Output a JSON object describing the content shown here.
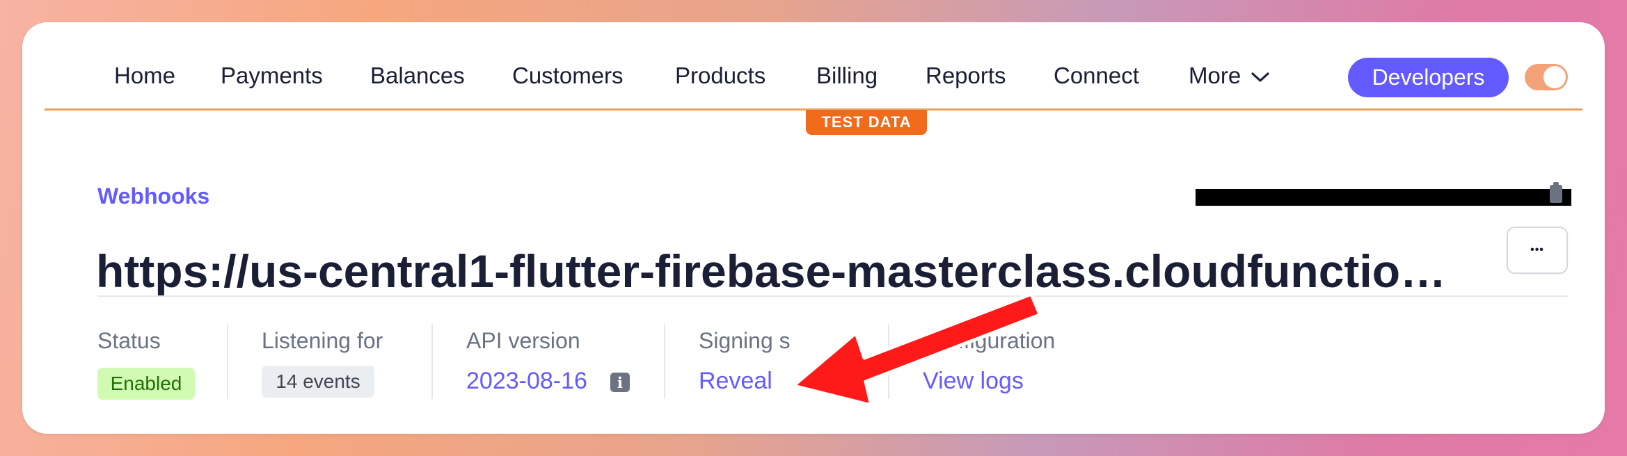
{
  "nav": {
    "items": [
      "Home",
      "Payments",
      "Balances",
      "Customers",
      "Products",
      "Billing",
      "Reports",
      "Connect"
    ],
    "more_label": "More",
    "developers_label": "Developers"
  },
  "badge": {
    "test_data": "TEST DATA"
  },
  "breadcrumb": "Webhooks",
  "endpoint": {
    "url": "https://us-central1-flutter-firebase-masterclass.cloudfunctio…",
    "actions_glyph": "•••"
  },
  "details": {
    "status_label": "Status",
    "status_value": "Enabled",
    "listening_label": "Listening for",
    "listening_value": "14 events",
    "api_label": "API version",
    "api_value": "2023-08-16",
    "signing_label": "Signing s",
    "signing_action": "Reveal",
    "config_label": "Configuration",
    "config_action": "View logs"
  },
  "colors": {
    "accent": "#635bff",
    "test_mode": "#f26b1d",
    "enabled_bg": "#d1fab3",
    "enabled_text": "#217005",
    "annotation_arrow": "#ff1a1a"
  },
  "icons": [
    "chevron-down-icon",
    "clipboard-icon",
    "info-icon",
    "more-dots-icon"
  ]
}
